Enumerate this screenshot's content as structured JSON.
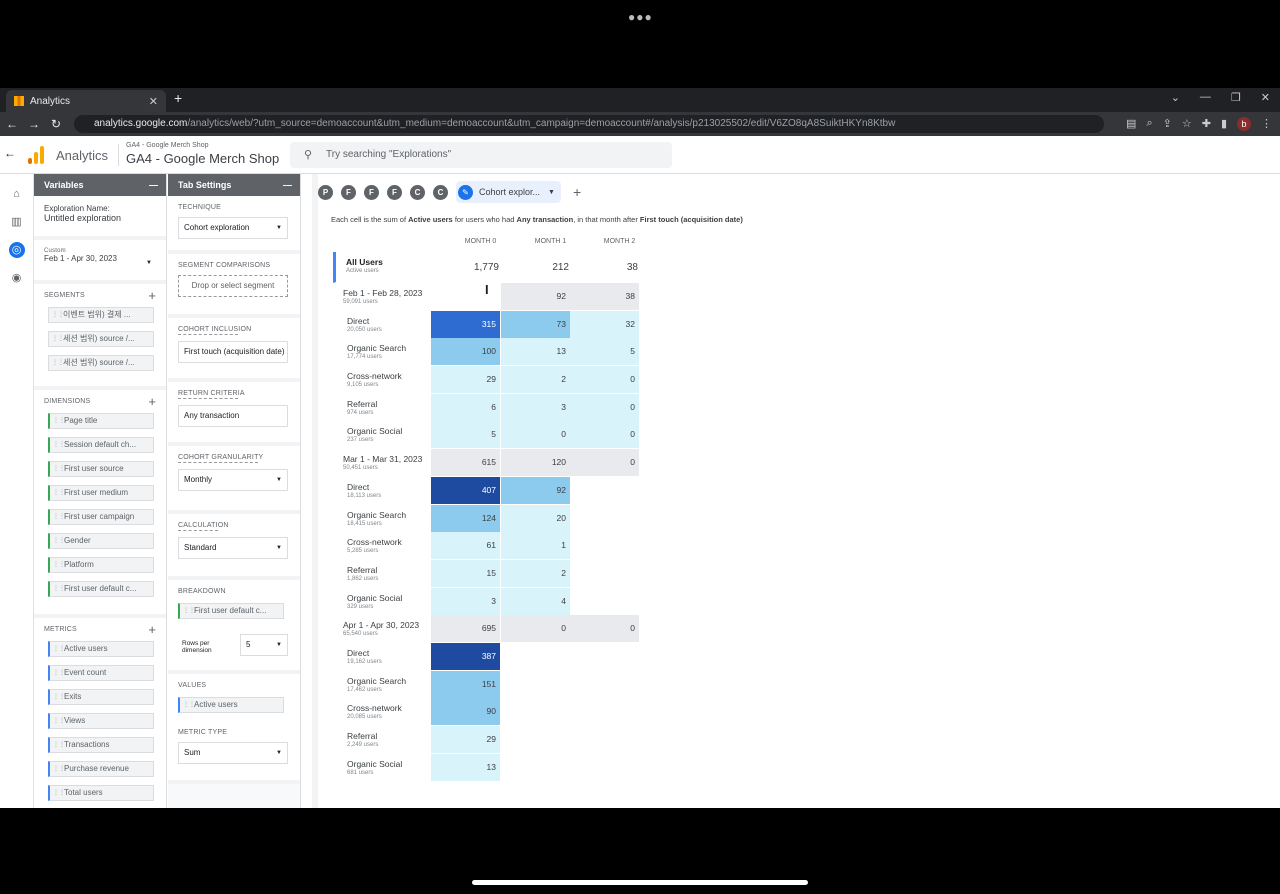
{
  "browser": {
    "tab_title": "Analytics",
    "url_domain": "analytics.google.com",
    "url_rest": "/analytics/web/?utm_source=demoaccount&utm_medium=demoaccount&utm_campaign=demoaccount#/analysis/p213025502/edit/V6ZO8qA8SuiktHKYn8Ktbw"
  },
  "header": {
    "app_name": "Analytics",
    "account": "GA4 - Google Merch Shop",
    "property": "GA4 - Google Merch Shop",
    "search_placeholder": "Try searching \"Explorations\""
  },
  "variables": {
    "title": "Variables",
    "exploration_name_label": "Exploration Name:",
    "exploration_name": "Untitled exploration",
    "date_custom": "Custom",
    "date_range": "Feb 1 - Apr 30, 2023",
    "segments_label": "SEGMENTS",
    "segments": [
      "이벤트 범위) 결제 ...",
      "세션 범위) source /...",
      "세션 범위) source /..."
    ],
    "dimensions_label": "DIMENSIONS",
    "dimensions": [
      "Page title",
      "Session default ch...",
      "First user source",
      "First user medium",
      "First user campaign",
      "Gender",
      "Platform",
      "First user default c..."
    ],
    "metrics_label": "METRICS",
    "metrics": [
      "Active users",
      "Event count",
      "Exits",
      "Views",
      "Transactions",
      "Purchase revenue",
      "Total users"
    ]
  },
  "tab_settings": {
    "title": "Tab Settings",
    "technique_label": "TECHNIQUE",
    "technique": "Cohort exploration",
    "segment_comparisons_label": "SEGMENT COMPARISONS",
    "segment_drop": "Drop or select segment",
    "cohort_inclusion_label": "COHORT INCLUSION",
    "cohort_inclusion": "First touch (acquisition date)",
    "return_criteria_label": "RETURN CRITERIA",
    "return_criteria": "Any transaction",
    "granularity_label": "COHORT GRANULARITY",
    "granularity": "Monthly",
    "calculation_label": "CALCULATION",
    "calculation": "Standard",
    "breakdown_label": "BREAKDOWN",
    "breakdown": "First user default c...",
    "rows_per_label": "Rows per dimension",
    "rows_per": "5",
    "values_label": "VALUES",
    "values": "Active users",
    "metric_type_label": "METRIC TYPE",
    "metric_type": "Sum"
  },
  "toolbar": {
    "circles": [
      "P",
      "F",
      "F",
      "F",
      "C",
      "C"
    ],
    "active_tab": "Cohort explor...",
    "add": "+"
  },
  "report": {
    "caption_parts": [
      "Each cell is the sum of ",
      "Active users",
      " for users who had ",
      "Any transaction",
      ", in that month after ",
      "First touch (acquisition date)"
    ],
    "headers": [
      "MONTH 0",
      "MONTH 1",
      "MONTH 2"
    ],
    "all_users": {
      "label": "All Users",
      "sub": "Active users",
      "values": [
        "1,779",
        "212",
        "38"
      ]
    },
    "cohorts": [
      {
        "label": "Feb 1 - Feb 28, 2023",
        "sub": "59,091 users",
        "values": [
          "",
          "92",
          "38"
        ],
        "rows": [
          {
            "label": "Direct",
            "sub": "20,050 users",
            "values": [
              "315",
              "73",
              "32"
            ]
          },
          {
            "label": "Organic Search",
            "sub": "17,774 users",
            "values": [
              "100",
              "13",
              "5"
            ]
          },
          {
            "label": "Cross-network",
            "sub": "9,105 users",
            "values": [
              "29",
              "2",
              "0"
            ]
          },
          {
            "label": "Referral",
            "sub": "974 users",
            "values": [
              "6",
              "3",
              "0"
            ]
          },
          {
            "label": "Organic Social",
            "sub": "237 users",
            "values": [
              "5",
              "0",
              "0"
            ]
          }
        ]
      },
      {
        "label": "Mar 1 - Mar 31, 2023",
        "sub": "50,451 users",
        "values": [
          "615",
          "120",
          "0"
        ],
        "rows": [
          {
            "label": "Direct",
            "sub": "18,113 users",
            "values": [
              "407",
              "92",
              ""
            ]
          },
          {
            "label": "Organic Search",
            "sub": "18,415 users",
            "values": [
              "124",
              "20",
              ""
            ]
          },
          {
            "label": "Cross-network",
            "sub": "5,285 users",
            "values": [
              "61",
              "1",
              ""
            ]
          },
          {
            "label": "Referral",
            "sub": "1,862 users",
            "values": [
              "15",
              "2",
              ""
            ]
          },
          {
            "label": "Organic Social",
            "sub": "329 users",
            "values": [
              "3",
              "4",
              ""
            ]
          }
        ]
      },
      {
        "label": "Apr 1 - Apr 30, 2023",
        "sub": "65,540 users",
        "values": [
          "695",
          "0",
          "0"
        ],
        "rows": [
          {
            "label": "Direct",
            "sub": "19,162 users",
            "values": [
              "387",
              "",
              ""
            ]
          },
          {
            "label": "Organic Search",
            "sub": "17,462 users",
            "values": [
              "151",
              "",
              ""
            ]
          },
          {
            "label": "Cross-network",
            "sub": "20,085 users",
            "values": [
              "90",
              "",
              ""
            ]
          },
          {
            "label": "Referral",
            "sub": "2,249 users",
            "values": [
              "29",
              "",
              ""
            ]
          },
          {
            "label": "Organic Social",
            "sub": "681 users",
            "values": [
              "13",
              "",
              ""
            ]
          }
        ]
      }
    ]
  },
  "colors": {
    "accent": "#1a73e8",
    "dark": "#1e4ba0",
    "mid": "#2f6cd1",
    "light": "#8ccbed",
    "pale": "#d9f3fb"
  }
}
